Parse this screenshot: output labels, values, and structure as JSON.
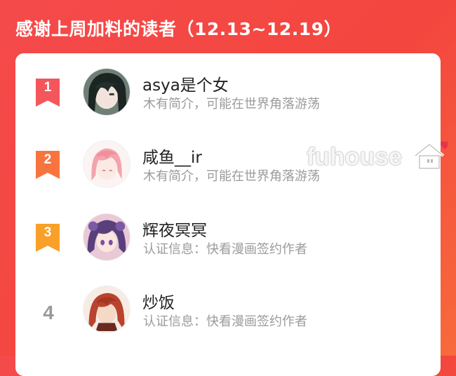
{
  "header": {
    "title": "感谢上周加料的读者（12.13~12.19）"
  },
  "readers": [
    {
      "rank": "1",
      "name": "asya是个女",
      "desc": "木有简介，可能在世界角落游荡",
      "badge_color": "#f4565b",
      "avatar": "dark-hair-avatar"
    },
    {
      "rank": "2",
      "name": "咸鱼__ir",
      "desc": "木有简介，可能在世界角落游荡",
      "badge_color": "#f8743f",
      "avatar": "pink-hair-avatar"
    },
    {
      "rank": "3",
      "name": "辉夜冥冥",
      "desc": "认证信息：快看漫画签约作者",
      "badge_color": "#f9a029",
      "avatar": "purple-hair-avatar"
    },
    {
      "rank": "4",
      "name": "炒饭",
      "desc": "认证信息：快看漫画签约作者",
      "badge_color": "",
      "avatar": "red-hair-avatar"
    }
  ],
  "watermark": {
    "text": "fuhouse",
    "icon": "house-heart-icon",
    "heart_color": "#e8314a"
  }
}
